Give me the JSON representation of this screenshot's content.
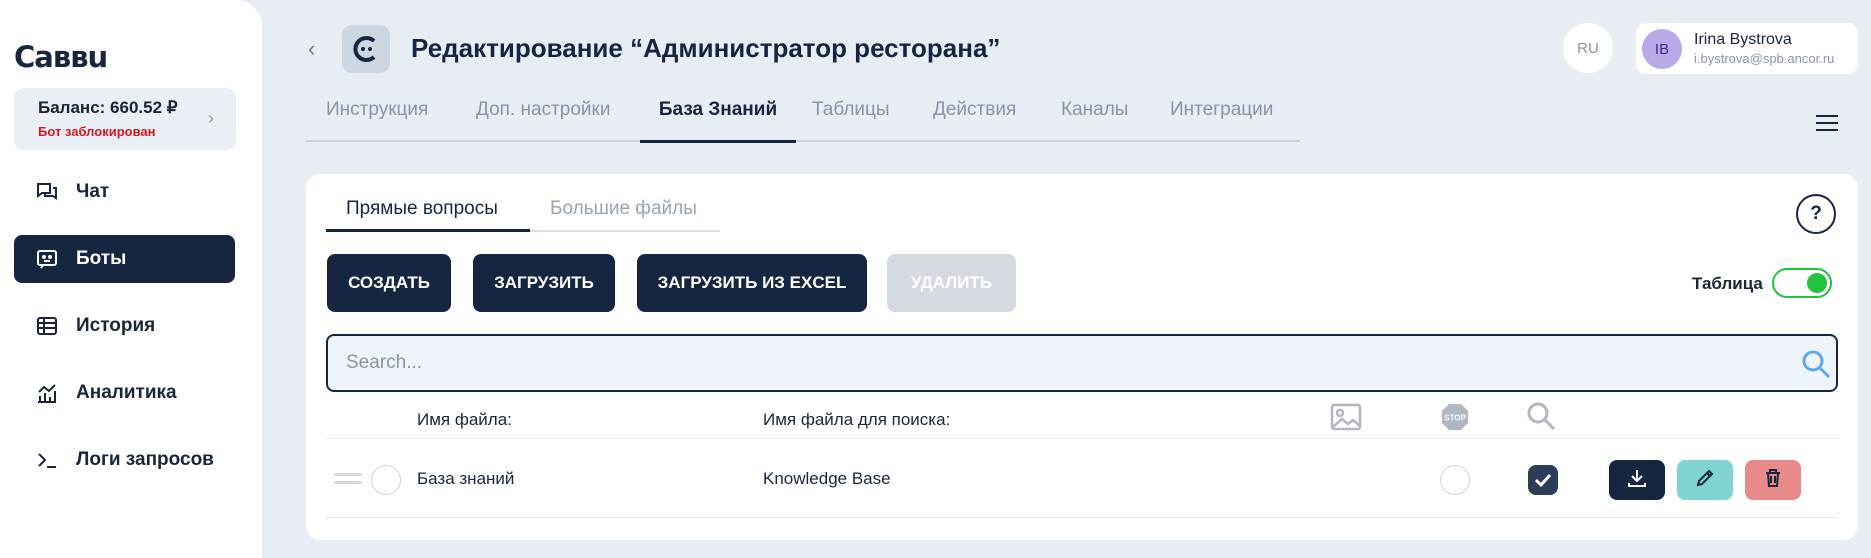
{
  "logo": "Саввu",
  "balance": {
    "title": "Баланс: 660.52 ₽",
    "status": "Бот заблокирован"
  },
  "nav": [
    {
      "label": "Чат",
      "icon": "chat-icon"
    },
    {
      "label": "Боты",
      "icon": "bot-icon",
      "active": true
    },
    {
      "label": "История",
      "icon": "table-icon"
    },
    {
      "label": "Аналитика",
      "icon": "analytics-icon"
    },
    {
      "label": "Логи запросов",
      "icon": "terminal-icon"
    }
  ],
  "header": {
    "title": "Редактирование “Администратор ресторана”"
  },
  "lang": "RU",
  "user": {
    "initials": "IB",
    "name": "Irina Bystrova",
    "email": "i.bystrova@spb.ancor.ru"
  },
  "tabs": [
    "Инструкция",
    "Доп. настройки",
    "База Знаний",
    "Таблицы",
    "Действия",
    "Каналы",
    "Интеграции"
  ],
  "active_tab": "База Знаний",
  "subtabs": [
    "Прямые вопросы",
    "Большие файлы"
  ],
  "buttons": {
    "create": "СОЗДАТЬ",
    "upload": "ЗАГРУЗИТЬ",
    "upload_excel": "ЗАГРУЗИТЬ ИЗ EXCEL",
    "delete": "УДАЛИТЬ"
  },
  "help": "?",
  "toggle": {
    "label": "Таблица",
    "on": true
  },
  "search": {
    "placeholder": "Search..."
  },
  "table": {
    "headers": {
      "file_name": "Имя файла:",
      "search_name": "Имя файла для поиска:"
    },
    "rows": [
      {
        "file_name": "База знаний",
        "search_name": "Knowledge Base",
        "stop": false,
        "searchable": true
      }
    ]
  },
  "colors": {
    "primary": "#172640",
    "toggle_on": "#22c33d",
    "edit": "#7fd3d3",
    "delete": "#e8898a",
    "danger_text": "#d1181f"
  }
}
